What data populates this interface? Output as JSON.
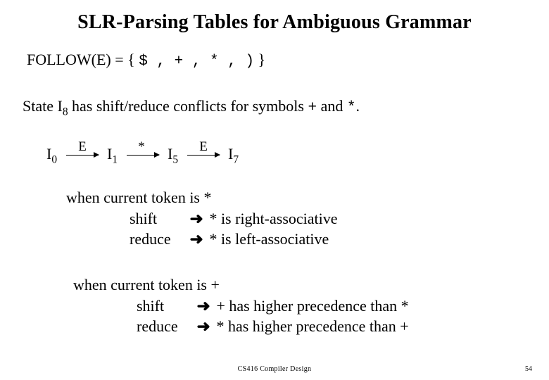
{
  "title": "SLR-Parsing Tables for Ambiguous Grammar",
  "follow": {
    "prefix": "FOLLOW(E) = { ",
    "symbols": "$ , + , * , )",
    "suffix": " }"
  },
  "state_line": {
    "p1": "State I",
    "sub": "8",
    "p2": " has shift/reduce conflicts for symbols ",
    "sym1": "+",
    "p3": " and ",
    "sym2": "*",
    "p4": "."
  },
  "chain": {
    "n0": {
      "label": "I",
      "sub": "0"
    },
    "e0": "E",
    "n1": {
      "label": "I",
      "sub": "1"
    },
    "e1": "*",
    "n2": {
      "label": "I",
      "sub": "5"
    },
    "e2": "E",
    "n3": {
      "label": "I",
      "sub": "7"
    }
  },
  "block_star": {
    "heading": "when current token is *",
    "shift_kw": "shift",
    "shift_text": "* is right-associative",
    "reduce_kw": "reduce",
    "reduce_text": "* is left-associative"
  },
  "block_plus": {
    "heading": "when current token is +",
    "shift_kw": "shift",
    "shift_text": "+ has higher precedence than *",
    "reduce_kw": "reduce",
    "reduce_text": "* has higher precedence than +"
  },
  "arrow_glyph": "➜",
  "footer_center": "CS416 Compiler Design",
  "footer_right": "54"
}
